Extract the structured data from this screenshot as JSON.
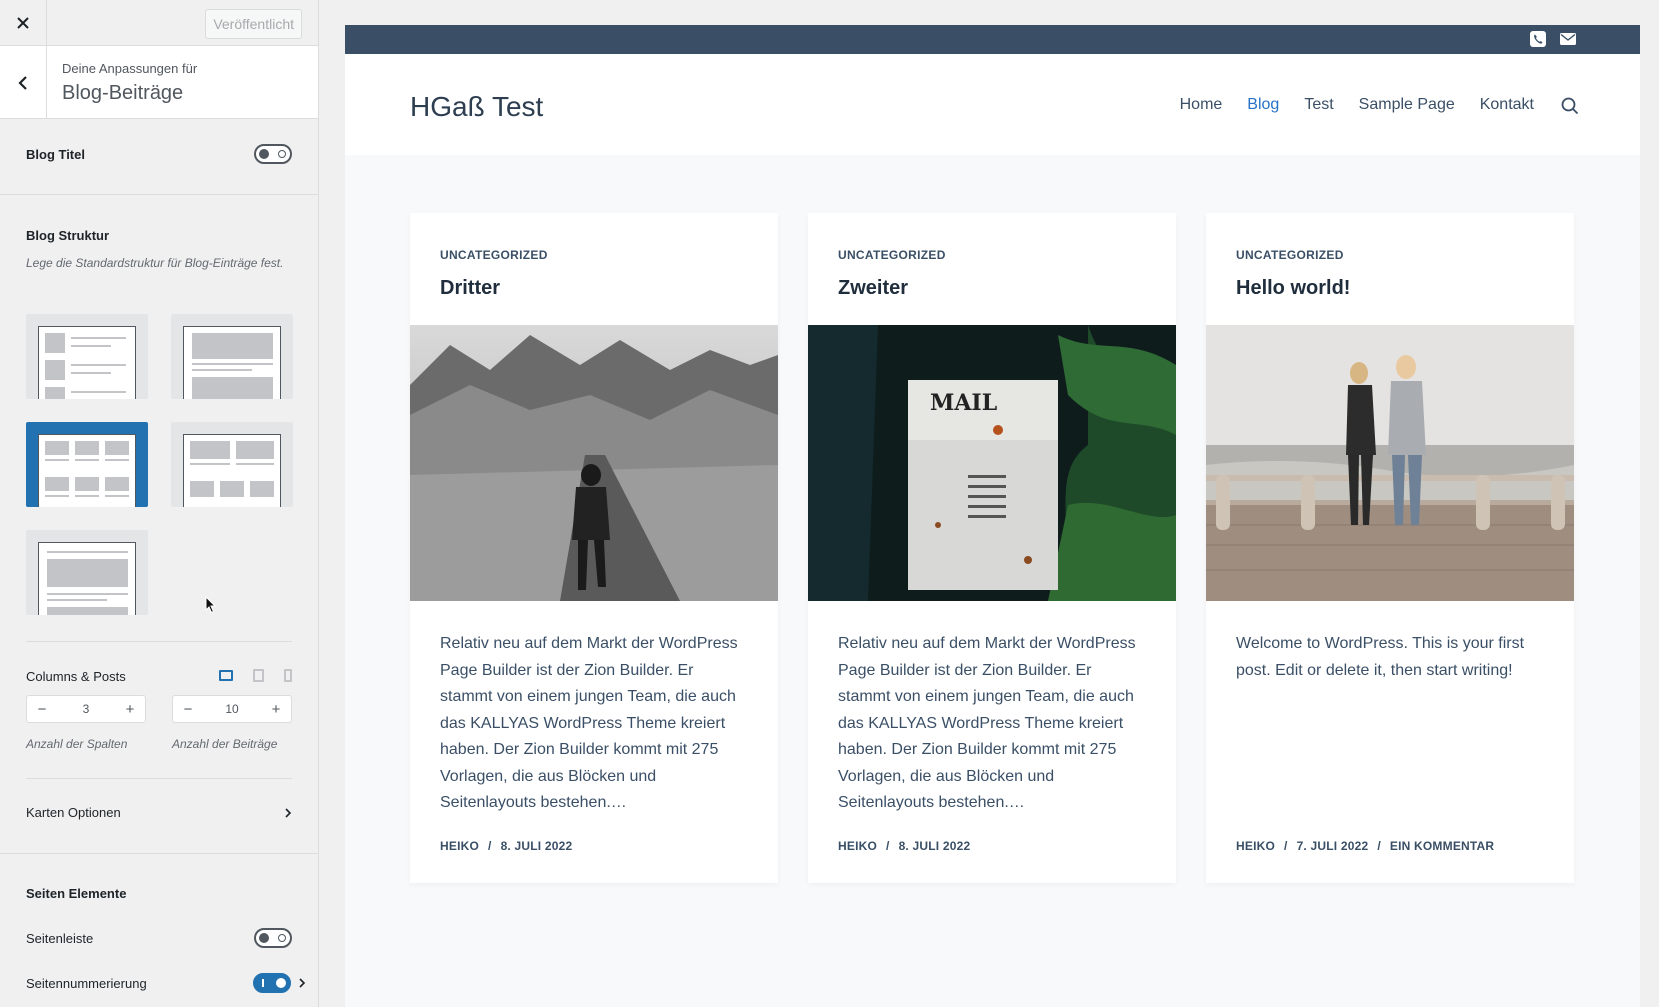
{
  "customizer": {
    "publish_label": "Veröffentlicht",
    "section_subtitle": "Deine Anpassungen für",
    "section_title": "Blog-Beiträge",
    "blog_title_label": "Blog Titel",
    "blog_title_enabled": false,
    "structure": {
      "label": "Blog Struktur",
      "description": "Lege die Standardstruktur für Blog-Einträge fest.",
      "selected_index": 2
    },
    "columns_posts": {
      "label": "Columns & Posts",
      "columns_value": "3",
      "posts_value": "10",
      "columns_desc": "Anzahl der Spalten",
      "posts_desc": "Anzahl der Beiträge",
      "active_device": "desktop"
    },
    "card_options_label": "Karten Optionen",
    "page_elements": {
      "label": "Seiten Elemente",
      "sidebar_label": "Seitenleiste",
      "sidebar_enabled": false,
      "pagination_label": "Seitennummerierung",
      "pagination_enabled": true
    }
  },
  "site": {
    "title": "HGaß Test",
    "nav": [
      "Home",
      "Blog",
      "Test",
      "Sample Page",
      "Kontakt"
    ],
    "active_nav": "Blog",
    "top_icons": [
      "phone-icon",
      "mail-icon"
    ]
  },
  "posts": [
    {
      "category": "UNCATEGORIZED",
      "title": "Dritter",
      "excerpt": "Relativ neu auf dem Markt der WordPress Page Builder ist der Zion Builder. Er stammt von einem jungen Team, die auch das KALLYAS WordPress Theme kreiert haben. Der Zion Builder kommt mit 275 Vorlagen, die aus Blöcken und Seitenlayouts bestehen.…",
      "author": "HEIKO",
      "date": "8. JULI 2022",
      "comments": ""
    },
    {
      "category": "UNCATEGORIZED",
      "title": "Zweiter",
      "excerpt": "Relativ neu auf dem Markt der WordPress Page Builder ist der Zion Builder. Er stammt von einem jungen Team, die auch das KALLYAS WordPress Theme kreiert haben. Der Zion Builder kommt mit 275 Vorlagen, die aus Blöcken und Seitenlayouts bestehen.…",
      "author": "HEIKO",
      "date": "8. JULI 2022",
      "comments": ""
    },
    {
      "category": "UNCATEGORIZED",
      "title": "Hello world!",
      "excerpt": "Welcome to WordPress. This is your first post. Edit or delete it, then start writing!",
      "author": "HEIKO",
      "date": "7. JULI 2022",
      "comments": "EIN KOMMENTAR"
    }
  ],
  "colors": {
    "accent": "#2271b1",
    "topstrip": "#3a4f66",
    "nav_active": "#2872c8"
  }
}
